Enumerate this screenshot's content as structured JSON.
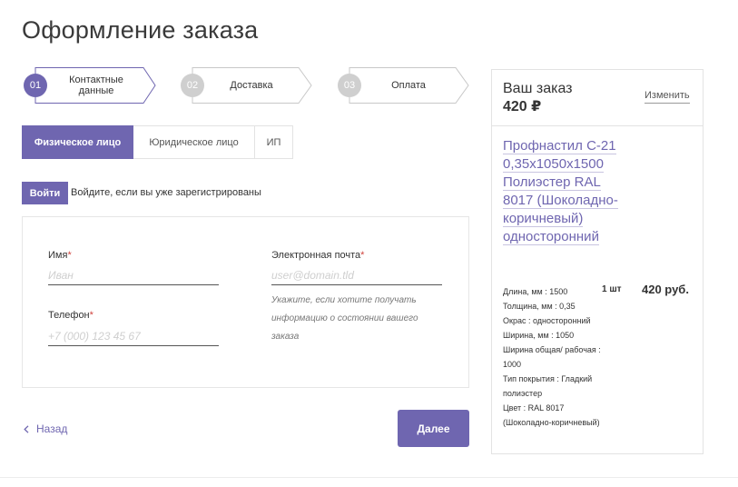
{
  "page": {
    "title": "Оформление заказа"
  },
  "steps": [
    {
      "num": "01",
      "label": "Контактные данные",
      "active": true
    },
    {
      "num": "02",
      "label": "Доставка",
      "active": false
    },
    {
      "num": "03",
      "label": "Оплата",
      "active": false
    }
  ],
  "tabs": [
    {
      "label": "Физическое лицо",
      "active": true
    },
    {
      "label": "Юридическое лицо",
      "active": false
    },
    {
      "label": "ИП",
      "active": false
    }
  ],
  "login": {
    "button_label": "Войти",
    "text": "Войдите, если вы уже зарегистрированы"
  },
  "form": {
    "name": {
      "label": "Имя",
      "required_mark": "*",
      "placeholder": "Иван",
      "value": ""
    },
    "phone": {
      "label": "Телефон",
      "required_mark": "*",
      "placeholder": "+7 (000) 123 45 67",
      "value": ""
    },
    "email": {
      "label": "Электронная почта",
      "required_mark": "*",
      "placeholder": "user@domain.tld",
      "value": "",
      "hint": "Укажите, если хотите получать информацию о состоянии вашего заказа"
    }
  },
  "nav": {
    "back_label": "Назад",
    "next_label": "Далее"
  },
  "order": {
    "title": "Ваш заказ",
    "total": "420 ₽",
    "edit_label": "Изменить",
    "item": {
      "name": "Профнастил С-21 0,35х1050х1500 Полиэстер RAL 8017 (Шоколадно-коричневый) односторонний",
      "properties": [
        "Длина, мм : 1500",
        "Толщина, мм : 0,35",
        "Окрас : односторонний",
        "Ширина, мм : 1050",
        "Ширина общая/ рабочая : 1000",
        "Тип покрытия : Гладкий полиэстер",
        "Цвет : RAL 8017 (Шоколадно-коричневый)"
      ],
      "qty": "1 шт",
      "price": "420 руб."
    }
  },
  "colors": {
    "accent": "#6f66b0",
    "step_inactive": "#cfcfcf",
    "required": "#d0453f",
    "border": "#e3e3e3"
  }
}
